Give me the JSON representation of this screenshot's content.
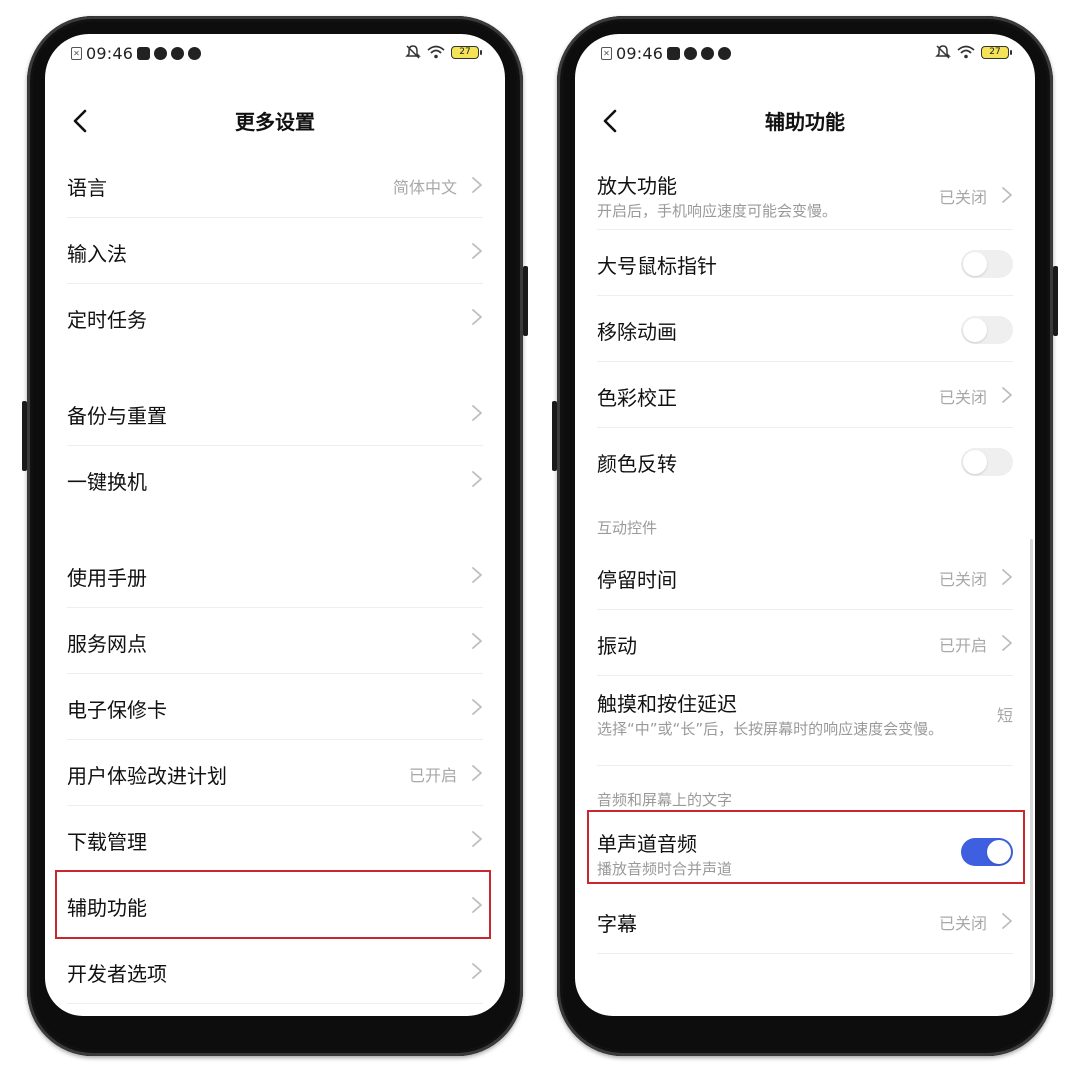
{
  "status_bar": {
    "time": "09:46",
    "battery_level": "27"
  },
  "left_screen": {
    "title": "更多设置",
    "groups": [
      [
        {
          "label": "语言",
          "value": "简体中文"
        },
        {
          "label": "输入法",
          "value": ""
        },
        {
          "label": "定时任务",
          "value": ""
        }
      ],
      [
        {
          "label": "备份与重置",
          "value": ""
        },
        {
          "label": "一键换机",
          "value": ""
        }
      ],
      [
        {
          "label": "使用手册",
          "value": ""
        },
        {
          "label": "服务网点",
          "value": ""
        },
        {
          "label": "电子保修卡",
          "value": ""
        },
        {
          "label": "用户体验改进计划",
          "value": "已开启"
        },
        {
          "label": "下载管理",
          "value": ""
        },
        {
          "label": "辅助功能",
          "value": "",
          "highlighted": true
        },
        {
          "label": "开发者选项",
          "value": ""
        }
      ]
    ]
  },
  "right_screen": {
    "title": "辅助功能",
    "items_top": [
      {
        "label": "放大功能",
        "sub": "开启后，手机响应速度可能会变慢。",
        "value": "已关闭",
        "type": "link"
      },
      {
        "label": "大号鼠标指针",
        "type": "toggle",
        "on": false
      },
      {
        "label": "移除动画",
        "type": "toggle",
        "on": false
      },
      {
        "label": "色彩校正",
        "value": "已关闭",
        "type": "link"
      },
      {
        "label": "颜色反转",
        "type": "toggle",
        "on": false
      }
    ],
    "section_interactive": "互动控件",
    "items_interactive": [
      {
        "label": "停留时间",
        "value": "已关闭",
        "type": "link"
      },
      {
        "label": "振动",
        "value": "已开启",
        "type": "link"
      },
      {
        "label": "触摸和按住延迟",
        "sub": "选择“中”或“长”后，长按屏幕时的响应速度会变慢。",
        "value": "短",
        "type": "text"
      }
    ],
    "section_audio": "音频和屏幕上的文字",
    "items_audio": [
      {
        "label": "单声道音频",
        "sub": "播放音频时合并声道",
        "type": "toggle",
        "on": true,
        "highlighted": true
      },
      {
        "label": "字幕",
        "value": "已关闭",
        "type": "link"
      }
    ]
  },
  "colors": {
    "toggle_on": "#3d5fe0",
    "highlight_border": "#c8272e"
  }
}
